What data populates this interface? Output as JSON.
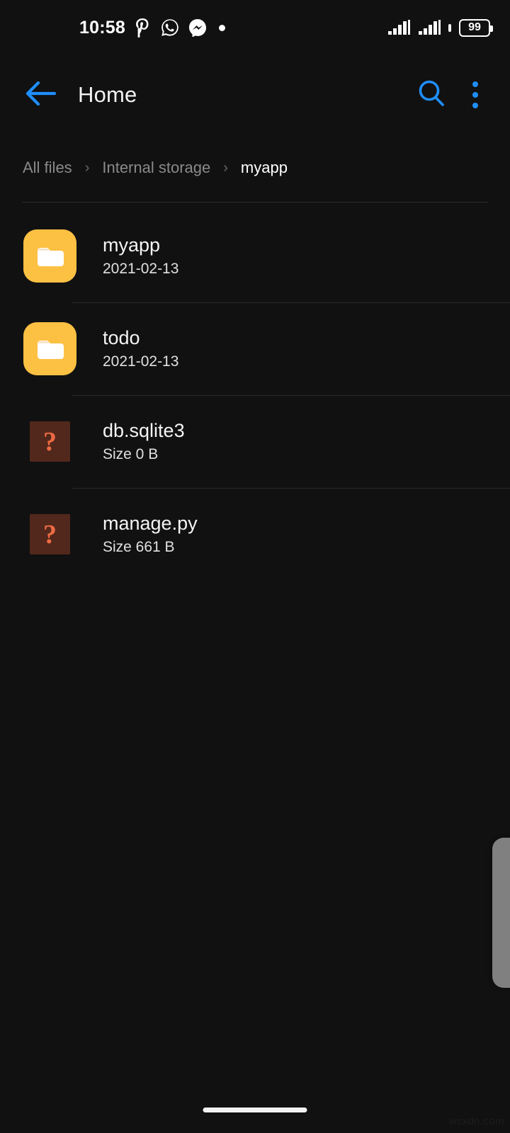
{
  "statusbar": {
    "time": "10:58",
    "icons": [
      {
        "name": "pinterest-icon",
        "glyph": "p"
      },
      {
        "name": "whatsapp-icon",
        "glyph": "whatsapp"
      },
      {
        "name": "messenger-icon",
        "glyph": "messenger"
      },
      {
        "name": "notification-dot-icon",
        "glyph": "dot"
      }
    ],
    "signal_label": "signal-bars",
    "battery_level": "99"
  },
  "appbar": {
    "back_icon": "back-arrow-icon",
    "title": "Home",
    "search_icon": "search-icon",
    "menu_icon": "overflow-menu-icon",
    "accent": "#1f8fff"
  },
  "breadcrumb": {
    "separator": "›",
    "items": [
      {
        "label": "All files",
        "active": false
      },
      {
        "label": "Internal storage",
        "active": false
      },
      {
        "label": "myapp",
        "active": true
      }
    ]
  },
  "filelist": {
    "rows": [
      {
        "name": "myapp",
        "meta": "2021-02-13",
        "kind": "folder",
        "icon": "folder-icon"
      },
      {
        "name": "todo",
        "meta": "2021-02-13",
        "kind": "folder",
        "icon": "folder-icon"
      },
      {
        "name": "db.sqlite3",
        "meta": "Size 0 B",
        "kind": "file",
        "icon": "unknown-file-icon"
      },
      {
        "name": "manage.py",
        "meta": "Size 661 B",
        "kind": "file",
        "icon": "unknown-file-icon"
      }
    ]
  },
  "colors": {
    "background": "#111111",
    "folder": "#fcc043",
    "file_tile": "#52281c",
    "file_glyph": "#ed6b43",
    "accent": "#1f8fff"
  },
  "footer": {
    "watermark": "wsxdn.com"
  }
}
